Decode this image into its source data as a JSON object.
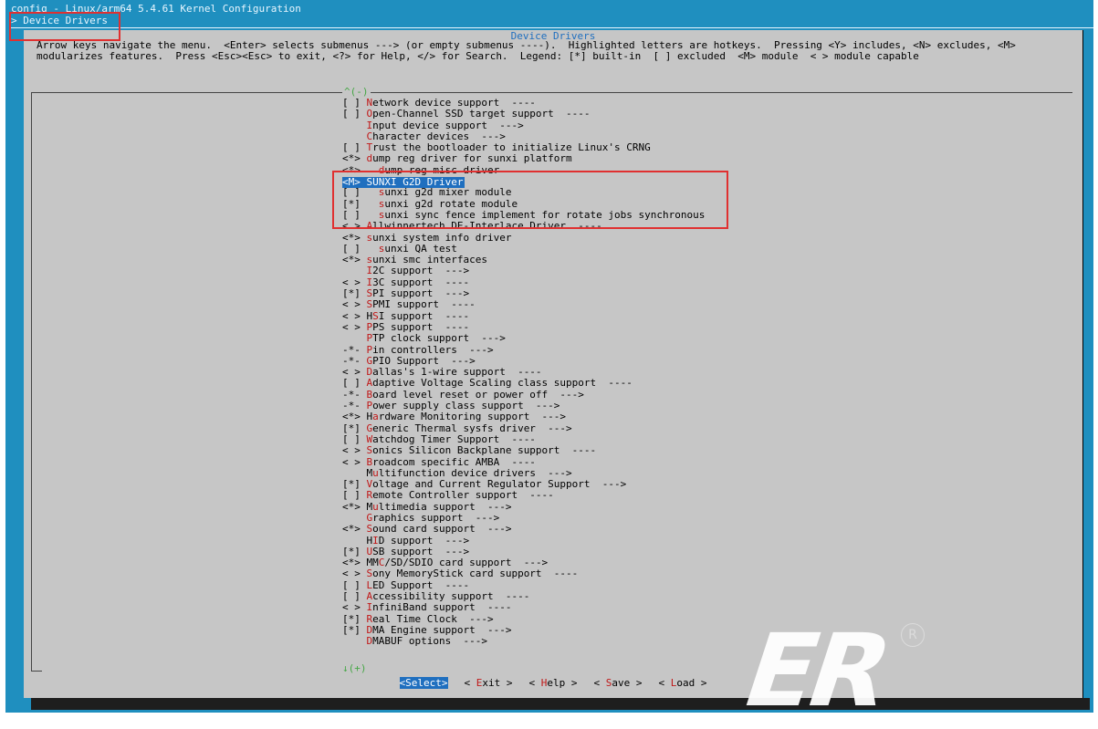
{
  "window": {
    "title": "config - Linux/arm64 5.4.61 Kernel Configuration",
    "breadcrumb": "> Device Drivers"
  },
  "dialog": {
    "title": "Device Drivers",
    "help": "Arrow keys navigate the menu.  <Enter> selects submenus ---> (or empty submenus ----).  Highlighted letters are hotkeys.  Pressing <Y> includes, <N> excludes, <M>\nmodularizes features.  Press <Esc><Esc> to exit, <?> for Help, </> for Search.  Legend: [*] built-in  [ ] excluded  <M> module  < > module capable",
    "scroll_up": "^(-)",
    "scroll_down": "↓(+)"
  },
  "menu": {
    "items": [
      {
        "prefix": "[ ] ",
        "hotkey": "N",
        "text": "etwork device support  ----"
      },
      {
        "prefix": "[ ] ",
        "hotkey": "O",
        "text": "pen-Channel SSD target support  ----"
      },
      {
        "prefix": "    ",
        "hotkey": "I",
        "text": "nput device support  --->"
      },
      {
        "prefix": "    ",
        "hotkey": "C",
        "text": "haracter devices  --->"
      },
      {
        "prefix": "[ ] ",
        "hotkey": "T",
        "text": "rust the bootloader to initialize Linux's CRNG"
      },
      {
        "prefix": "<*> ",
        "hotkey": "d",
        "text": "ump reg driver for sunxi platform"
      },
      {
        "prefix": "<*>   ",
        "hotkey": "d",
        "text": "ump reg misc driver"
      },
      {
        "prefix": "<M> ",
        "hotkey": "S",
        "text": "UNXI G2D Driver",
        "selected": true
      },
      {
        "prefix": "[ ]   ",
        "hotkey": "s",
        "text": "unxi g2d mixer module"
      },
      {
        "prefix": "[*]   ",
        "hotkey": "s",
        "text": "unxi g2d rotate module"
      },
      {
        "prefix": "[ ]   ",
        "hotkey": "s",
        "text": "unxi sync fence implement for rotate jobs synchronous"
      },
      {
        "prefix": "< > ",
        "hotkey": "A",
        "text": "llwinnertech DE-Interlace Driver  ----"
      },
      {
        "prefix": "<*> ",
        "hotkey": "s",
        "text": "unxi system info driver"
      },
      {
        "prefix": "[ ]   ",
        "hotkey": "s",
        "text": "unxi QA test"
      },
      {
        "prefix": "<*> ",
        "hotkey": "s",
        "text": "unxi smc interfaces"
      },
      {
        "prefix": "    ",
        "hotkey": "I",
        "text": "2C support  --->"
      },
      {
        "prefix": "< > ",
        "hotkey": "I",
        "text": "3C support  ----"
      },
      {
        "prefix": "[*] ",
        "hotkey": "S",
        "text": "PI support  --->"
      },
      {
        "prefix": "< > ",
        "hotkey": "S",
        "text": "PMI support  ----"
      },
      {
        "prefix": "< > H",
        "hotkey": "S",
        "text": "I support  ----"
      },
      {
        "prefix": "< > ",
        "hotkey": "P",
        "text": "PS support  ----"
      },
      {
        "prefix": "    ",
        "hotkey": "P",
        "text": "TP clock support  --->"
      },
      {
        "prefix": "-*- ",
        "hotkey": "P",
        "text": "in controllers  --->"
      },
      {
        "prefix": "-*- ",
        "hotkey": "G",
        "text": "PIO Support  --->"
      },
      {
        "prefix": "< > ",
        "hotkey": "D",
        "text": "allas's 1-wire support  ----"
      },
      {
        "prefix": "[ ] ",
        "hotkey": "A",
        "text": "daptive Voltage Scaling class support  ----"
      },
      {
        "prefix": "-*- ",
        "hotkey": "B",
        "text": "oard level reset or power off  --->"
      },
      {
        "prefix": "-*- ",
        "hotkey": "P",
        "text": "ower supply class support  --->"
      },
      {
        "prefix": "<*> H",
        "hotkey": "a",
        "text": "rdware Monitoring support  --->"
      },
      {
        "prefix": "[*] ",
        "hotkey": "G",
        "text": "eneric Thermal sysfs driver  --->"
      },
      {
        "prefix": "[ ] ",
        "hotkey": "W",
        "text": "atchdog Timer Support  ----"
      },
      {
        "prefix": "< > ",
        "hotkey": "S",
        "text": "onics Silicon Backplane support  ----"
      },
      {
        "prefix": "< > ",
        "hotkey": "B",
        "text": "roadcom specific AMBA  ----"
      },
      {
        "prefix": "    M",
        "hotkey": "u",
        "text": "ltifunction device drivers  --->"
      },
      {
        "prefix": "[*] ",
        "hotkey": "V",
        "text": "oltage and Current Regulator Support  --->"
      },
      {
        "prefix": "[ ] ",
        "hotkey": "R",
        "text": "emote Controller support  ----"
      },
      {
        "prefix": "<*> M",
        "hotkey": "u",
        "text": "ltimedia support  --->"
      },
      {
        "prefix": "    ",
        "hotkey": "G",
        "text": "raphics support  --->"
      },
      {
        "prefix": "<*> ",
        "hotkey": "S",
        "text": "ound card support  --->"
      },
      {
        "prefix": "    H",
        "hotkey": "I",
        "text": "D support  --->"
      },
      {
        "prefix": "[*] ",
        "hotkey": "U",
        "text": "SB support  --->"
      },
      {
        "prefix": "<*> MM",
        "hotkey": "C",
        "text": "/SD/SDIO card support  --->"
      },
      {
        "prefix": "< > ",
        "hotkey": "S",
        "text": "ony MemoryStick card support  ----"
      },
      {
        "prefix": "[ ] ",
        "hotkey": "L",
        "text": "ED Support  ----"
      },
      {
        "prefix": "[ ] ",
        "hotkey": "A",
        "text": "ccessibility support  ----"
      },
      {
        "prefix": "< > ",
        "hotkey": "I",
        "text": "nfiniBand support  ----"
      },
      {
        "prefix": "[*] ",
        "hotkey": "R",
        "text": "eal Time Clock  --->"
      },
      {
        "prefix": "[*] ",
        "hotkey": "D",
        "text": "MA Engine support  --->"
      },
      {
        "prefix": "    ",
        "hotkey": "D",
        "text": "MABUF options  --->"
      }
    ]
  },
  "buttons": [
    {
      "open": "<",
      "hotkey": "S",
      "rest": "elect>",
      "active": true,
      "name": "select-button"
    },
    {
      "open": "< ",
      "hotkey": "E",
      "rest": "xit >",
      "active": false,
      "name": "exit-button"
    },
    {
      "open": "< ",
      "hotkey": "H",
      "rest": "elp >",
      "active": false,
      "name": "help-button"
    },
    {
      "open": "< ",
      "hotkey": "S",
      "rest": "ave >",
      "active": false,
      "name": "save-button"
    },
    {
      "open": "< ",
      "hotkey": "L",
      "rest": "oad >",
      "active": false,
      "name": "load-button"
    }
  ],
  "watermark": {
    "text": "ER",
    "reg": "R"
  },
  "colors": {
    "background": "#1f8fbf",
    "dialog": "#c6c6c6",
    "highlight": "#1f6fbf",
    "hotkey": "#c01818",
    "annotation": "#e03030"
  }
}
